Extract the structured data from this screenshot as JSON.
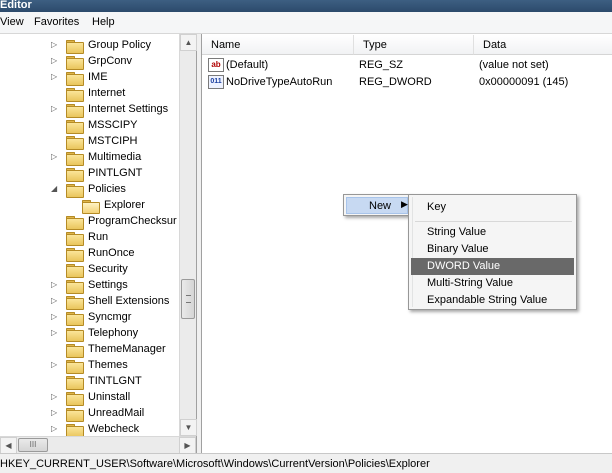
{
  "window": {
    "title": "Editor"
  },
  "menu": [
    "View",
    "Favorites",
    "Help"
  ],
  "tree": {
    "items": [
      {
        "label": "Group Policy",
        "expanded": false,
        "has_children": true
      },
      {
        "label": "GrpConv",
        "expanded": false,
        "has_children": true
      },
      {
        "label": "IME",
        "expanded": false,
        "has_children": true
      },
      {
        "label": "Internet",
        "expanded": false,
        "has_children": false
      },
      {
        "label": "Internet Settings",
        "expanded": false,
        "has_children": true
      },
      {
        "label": "MSSCIPY",
        "expanded": false,
        "has_children": false
      },
      {
        "label": "MSTCIPH",
        "expanded": false,
        "has_children": false
      },
      {
        "label": "Multimedia",
        "expanded": false,
        "has_children": true
      },
      {
        "label": "PINTLGNT",
        "expanded": false,
        "has_children": false
      },
      {
        "label": "Policies",
        "expanded": true,
        "has_children": true
      },
      {
        "label": "Explorer",
        "expanded": false,
        "has_children": false,
        "selected": true,
        "indent": 1
      },
      {
        "label": "ProgramChecksur",
        "expanded": false,
        "has_children": false
      },
      {
        "label": "Run",
        "expanded": false,
        "has_children": false
      },
      {
        "label": "RunOnce",
        "expanded": false,
        "has_children": false
      },
      {
        "label": "Security",
        "expanded": false,
        "has_children": false
      },
      {
        "label": "Settings",
        "expanded": false,
        "has_children": true
      },
      {
        "label": "Shell Extensions",
        "expanded": false,
        "has_children": true
      },
      {
        "label": "Syncmgr",
        "expanded": false,
        "has_children": true
      },
      {
        "label": "Telephony",
        "expanded": false,
        "has_children": true
      },
      {
        "label": "ThemeManager",
        "expanded": false,
        "has_children": false
      },
      {
        "label": "Themes",
        "expanded": false,
        "has_children": true
      },
      {
        "label": "TINTLGNT",
        "expanded": false,
        "has_children": false
      },
      {
        "label": "Uninstall",
        "expanded": false,
        "has_children": true
      },
      {
        "label": "UnreadMail",
        "expanded": false,
        "has_children": true
      },
      {
        "label": "Webcheck",
        "expanded": false,
        "has_children": true
      }
    ]
  },
  "values": {
    "columns": [
      "Name",
      "Type",
      "Data"
    ],
    "rows": [
      {
        "icon": "string-value-icon",
        "icon_text": "ab",
        "name": "(Default)",
        "type": "REG_SZ",
        "data": "(value not set)"
      },
      {
        "icon": "binary-value-icon",
        "icon_text": "011",
        "name": "NoDriveTypeAutoRun",
        "type": "REG_DWORD",
        "data": "0x00000091 (145)"
      }
    ]
  },
  "context_menu": {
    "parent_label": "New",
    "items": [
      "Key",
      "String Value",
      "Binary Value",
      "DWORD Value",
      "Multi-String Value",
      "Expandable String Value"
    ],
    "highlighted": "DWORD Value"
  },
  "status": {
    "path": "HKEY_CURRENT_USER\\Software\\Microsoft\\Windows\\CurrentVersion\\Policies\\Explorer"
  },
  "colors": {
    "highlight": "#696969",
    "folder": "#e9c55c"
  }
}
